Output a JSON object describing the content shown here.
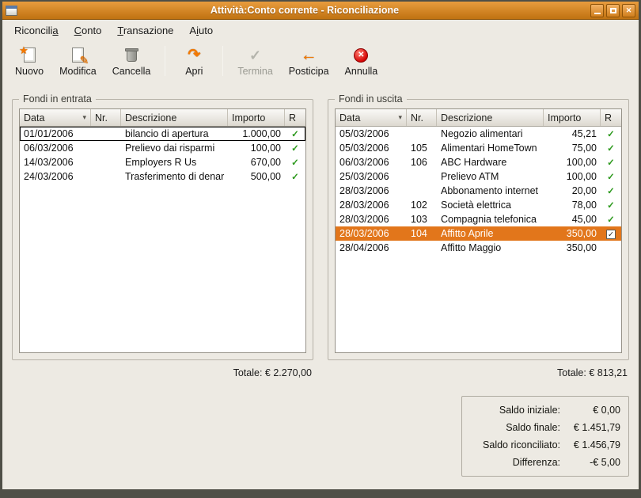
{
  "window": {
    "title": "Attività:Conto corrente - Riconciliazione"
  },
  "icons": {
    "close": "✕",
    "sort_arrow": "▾"
  },
  "menu": {
    "items": [
      {
        "pre": "Riconcili",
        "key": "a",
        "post": ""
      },
      {
        "pre": "",
        "key": "C",
        "post": "onto"
      },
      {
        "pre": "",
        "key": "T",
        "post": "ransazione"
      },
      {
        "pre": "A",
        "key": "i",
        "post": "uto"
      }
    ]
  },
  "toolbar": {
    "buttons": [
      {
        "label": "Nuovo",
        "glyph": "★"
      },
      {
        "label": "Modifica",
        "glyph": "✎"
      },
      {
        "label": "Cancella",
        "glyph": ""
      },
      {
        "label": "Apri",
        "glyph": "↷"
      },
      {
        "label": "Termina",
        "glyph": "✓",
        "disabled": true
      },
      {
        "label": "Posticipa",
        "glyph": "←"
      },
      {
        "label": "Annulla",
        "glyph": "✕"
      }
    ]
  },
  "funds_in": {
    "legend": "Fondi in entrata",
    "columns": {
      "data": "Data",
      "nr": "Nr.",
      "desc": "Descrizione",
      "importo": "Importo",
      "r": "R"
    },
    "rows": [
      {
        "data": "01/01/2006",
        "nr": "",
        "desc": "bilancio di apertura",
        "importo": "1.000,00",
        "r": "✓",
        "focused": true
      },
      {
        "data": "06/03/2006",
        "nr": "",
        "desc": "Prelievo dai risparmi",
        "importo": "100,00",
        "r": "✓"
      },
      {
        "data": "14/03/2006",
        "nr": "",
        "desc": "Employers R Us",
        "importo": "670,00",
        "r": "✓"
      },
      {
        "data": "24/03/2006",
        "nr": "",
        "desc": "Trasferimento di denar",
        "importo": "500,00",
        "r": "✓"
      }
    ],
    "total": "Totale: € 2.270,00"
  },
  "funds_out": {
    "legend": "Fondi in uscita",
    "columns": {
      "data": "Data",
      "nr": "Nr.",
      "desc": "Descrizione",
      "importo": "Importo",
      "r": "R"
    },
    "rows": [
      {
        "data": "05/03/2006",
        "nr": "",
        "desc": "Negozio alimentari",
        "importo": "45,21",
        "r": "✓"
      },
      {
        "data": "05/03/2006",
        "nr": "105",
        "desc": "Alimentari HomeTown",
        "importo": "75,00",
        "r": "✓"
      },
      {
        "data": "06/03/2006",
        "nr": "106",
        "desc": "ABC Hardware",
        "importo": "100,00",
        "r": "✓"
      },
      {
        "data": "25/03/2006",
        "nr": "",
        "desc": "Prelievo ATM",
        "importo": "100,00",
        "r": "✓"
      },
      {
        "data": "28/03/2006",
        "nr": "",
        "desc": "Abbonamento internet",
        "importo": "20,00",
        "r": "✓"
      },
      {
        "data": "28/03/2006",
        "nr": "102",
        "desc": "Società elettrica",
        "importo": "78,00",
        "r": "✓"
      },
      {
        "data": "28/03/2006",
        "nr": "103",
        "desc": "Compagnia telefonica",
        "importo": "45,00",
        "r": "✓"
      },
      {
        "data": "28/03/2006",
        "nr": "104",
        "desc": "Affitto Aprile",
        "importo": "350,00",
        "r": "✓",
        "selected": true
      },
      {
        "data": "28/04/2006",
        "nr": "",
        "desc": "Affitto Maggio",
        "importo": "350,00",
        "r": ""
      }
    ],
    "total": "Totale: € 813,21"
  },
  "summary": {
    "rows": [
      {
        "label": "Saldo iniziale:",
        "value": "€ 0,00"
      },
      {
        "label": "Saldo finale:",
        "value": "€ 1.451,79"
      },
      {
        "label": "Saldo riconciliato:",
        "value": "€ 1.456,79"
      },
      {
        "label": "Differenza:",
        "value": "-€ 5,00"
      }
    ]
  }
}
